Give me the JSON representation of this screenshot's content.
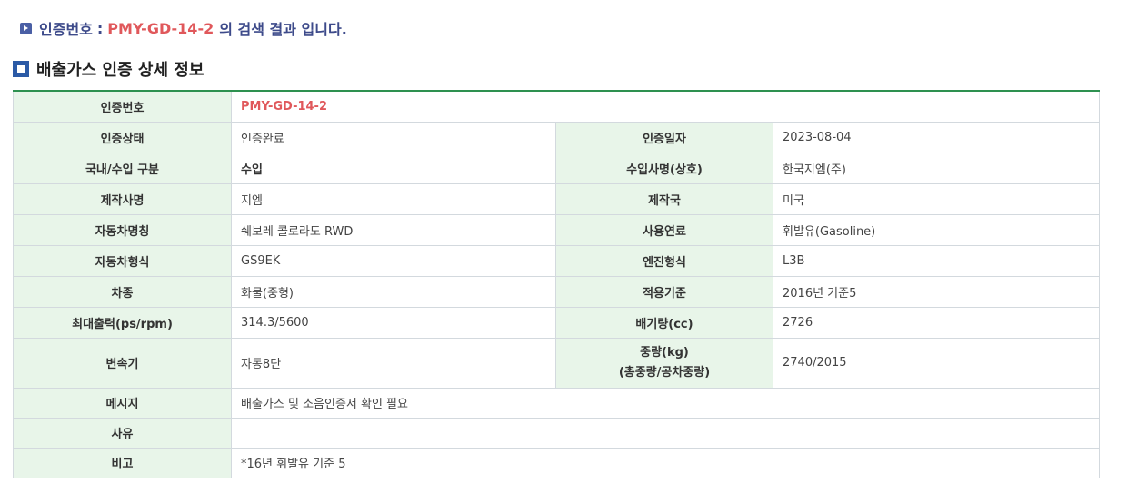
{
  "search_result": {
    "label": "인증번호",
    "colon": ":",
    "value": "PMY-GD-14-2",
    "suffix": "의 검색 결과 입니다."
  },
  "section": {
    "title": "배출가스 인증 상세 정보"
  },
  "detail": {
    "cert_no": {
      "label": "인증번호",
      "value": "PMY-GD-14-2"
    },
    "cert_status": {
      "label": "인증상태",
      "value": "인증완료"
    },
    "cert_date": {
      "label": "인증일자",
      "value": "2023-08-04"
    },
    "domestic_import": {
      "label": "국내/수입 구분",
      "value": "수입"
    },
    "importer": {
      "label": "수입사명(상호)",
      "value": "한국지엠(주)"
    },
    "manufacturer": {
      "label": "제작사명",
      "value": "지엠"
    },
    "country": {
      "label": "제작국",
      "value": "미국"
    },
    "vehicle_name": {
      "label": "자동차명칭",
      "value": "쉐보레 콜로라도 RWD"
    },
    "fuel": {
      "label": "사용연료",
      "value": "휘발유(Gasoline)"
    },
    "vehicle_type": {
      "label": "자동차형식",
      "value": "GS9EK"
    },
    "engine_type": {
      "label": "엔진형식",
      "value": "L3B"
    },
    "vehicle_class": {
      "label": "차종",
      "value": "화물(중형)"
    },
    "standard": {
      "label": "적용기준",
      "value": "2016년 기준5"
    },
    "max_output": {
      "label": "최대출력(ps/rpm)",
      "value": "314.3/5600"
    },
    "displacement": {
      "label": "배기량(cc)",
      "value": "2726"
    },
    "transmission": {
      "label": "변속기",
      "value": "자동8단"
    },
    "weight": {
      "label_line1": "중량(kg)",
      "label_line2": "(총중량/공차중량)",
      "value": "2740/2015"
    },
    "message": {
      "label": "메시지",
      "value": "배출가스 및 소음인증서 확인 필요"
    },
    "reason": {
      "label": "사유",
      "value": ""
    },
    "remark": {
      "label": "비고",
      "value": "*16년 휘발유 기준 5"
    }
  }
}
